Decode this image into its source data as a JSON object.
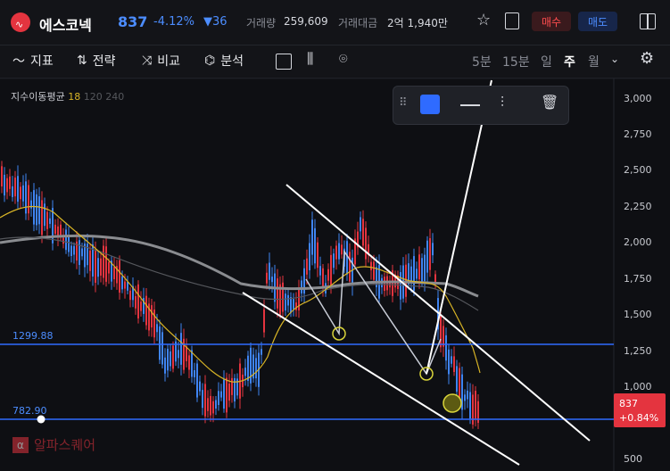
{
  "header": {
    "name": "에스코넥",
    "price": "837",
    "change_pct": "-4.12%",
    "change_abs": "▼36",
    "volume_label": "거래량",
    "volume": "259,609",
    "amount_label": "거래대금",
    "amount": "2억 1,940만",
    "buy_label": "매수",
    "sell_label": "매도"
  },
  "toolbar": {
    "indicator": "지표",
    "drawing": "전략",
    "compare": "비교",
    "analysis": "분석",
    "timeframes": [
      "5분",
      "15분",
      "일",
      "주",
      "월"
    ],
    "active_timeframe": "주"
  },
  "legend": {
    "title": "지수이동평균",
    "p1": "18",
    "p2": "120",
    "p3": "240"
  },
  "axis": {
    "ticks": [
      "3,000",
      "2,750",
      "2,500",
      "2,250",
      "2,000",
      "1,750",
      "1,500",
      "1,250",
      "1,000",
      "500"
    ]
  },
  "levels": {
    "upper": "1299.88",
    "lower": "782.90"
  },
  "price_tag": {
    "value": "837",
    "change": "+0.84%"
  },
  "watermark": "알파스퀘어",
  "colors": {
    "up": "#e4343f",
    "down": "#3f84f2",
    "accent_blue": "#2f6bff",
    "ema18": "#d9b526"
  },
  "chart_data": {
    "type": "candlestick",
    "ylim": [
      500,
      3100
    ],
    "levels": [
      1299.88,
      782.9
    ],
    "last_price": 837,
    "ema_periods": [
      18,
      120,
      240
    ]
  }
}
